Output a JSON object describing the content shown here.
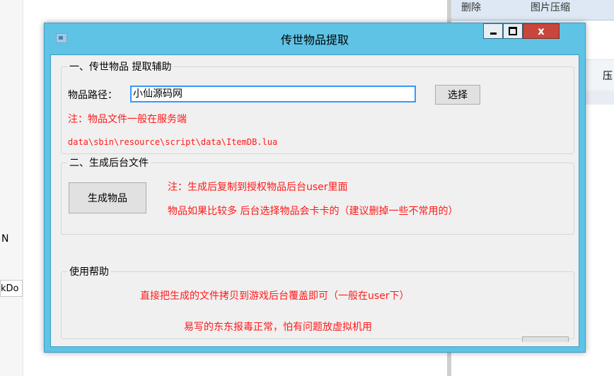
{
  "background": {
    "right_top": [
      "删除",
      "图片压缩"
    ],
    "right_band_text": "压",
    "left_text_n": "N",
    "left_text_k": "kDo"
  },
  "window": {
    "title": "传世物品提取",
    "controls": {
      "close": "x"
    },
    "accent": "#5fc3e6",
    "close_color": "#c7463d"
  },
  "group1": {
    "legend": "一、传世物品 提取辅助",
    "path_label": "物品路径：",
    "path_value": "小仙源码网",
    "select_button": "选择",
    "note": "注：物品文件一般在服务端",
    "path_hint": "data\\sbin\\resource\\script\\data\\ItemDB.lua"
  },
  "group2": {
    "legend": "二、生成后台文件",
    "generate_button": "生成物品",
    "note1": "注：生成后复制到授权物品后台user里面",
    "note2": "物品如果比较多 后台选择物品会卡卡的（建议删掉一些不常用的）"
  },
  "group3": {
    "legend": "使用帮助",
    "help1": "直接把生成的文件拷贝到游戏后台覆盖即可（一般在user下）",
    "help2": "易写的东东报毒正常，怕有问题放虚拟机用"
  },
  "colors": {
    "note_red": "#ff1a1a"
  }
}
